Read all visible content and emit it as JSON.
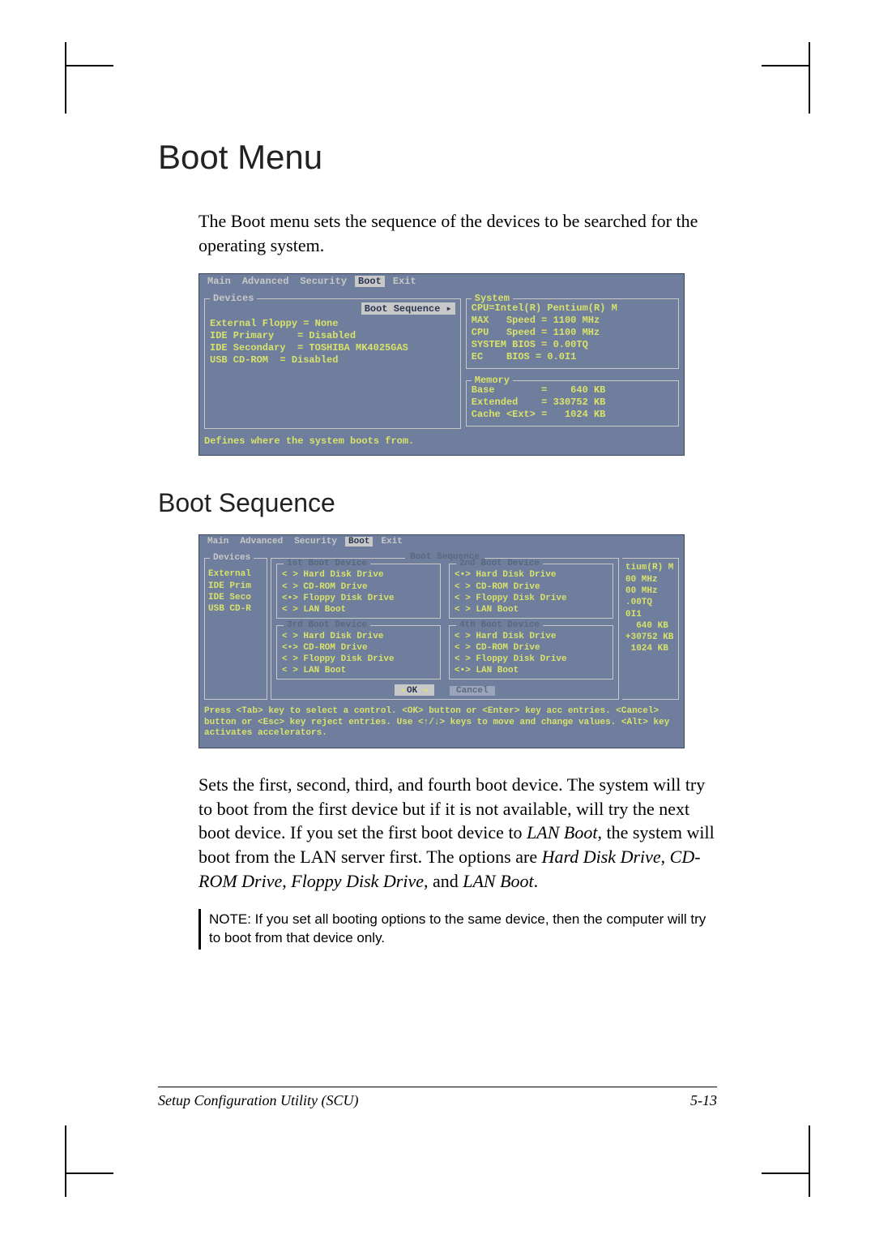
{
  "title": "Boot Menu",
  "intro": "The Boot menu sets the sequence of the devices to be searched for the operating system.",
  "bios1": {
    "menubar": [
      "Main",
      "Advanced",
      "Security",
      "Boot",
      "Exit"
    ],
    "active_tab": "Boot",
    "devices_title": "Devices",
    "boot_seq_button": "Boot Sequence ▸",
    "dev_lines": [
      "External Floppy = None",
      "IDE Primary    = Disabled",
      "IDE Secondary  = TOSHIBA MK4025GAS",
      "USB CD-ROM  = Disabled"
    ],
    "system_title": "System",
    "system_lines": [
      "CPU=Intel(R) Pentium(R) M",
      "MAX   Speed = 1100 MHz",
      "CPU   Speed = 1100 MHz",
      "SYSTEM BIOS = 0.00TQ",
      "EC    BIOS = 0.0I1"
    ],
    "memory_title": "Memory",
    "memory_lines": [
      "Base        =    640 KB",
      "Extended    = 330752 KB",
      "Cache <Ext> =   1024 KB"
    ],
    "status": "Defines where the system boots from."
  },
  "subtitle": "Boot Sequence",
  "bios2": {
    "menubar": [
      "Main",
      "Advanced",
      "Security",
      "Boot",
      "Exit"
    ],
    "active_tab": "Boot",
    "devices_title": "Devices",
    "dev_left": [
      "External",
      "IDE Prim",
      "IDE Seco",
      "USB CD-R"
    ],
    "seq_title": "Boot Sequence",
    "box1_title": "1st Boot Device",
    "box2_title": "2nd Boot Device",
    "box3_title": "3rd Boot Device",
    "box4_title": "4th Boot Device",
    "box1_opts": [
      "< > Hard Disk Drive",
      "< > CD-ROM Drive",
      "<•> Floppy Disk Drive",
      "< > LAN Boot"
    ],
    "box2_opts": [
      "<•> Hard Disk Drive",
      "< > CD-ROM Drive",
      "< > Floppy Disk Drive",
      "< > LAN Boot"
    ],
    "box3_opts": [
      "< > Hard Disk Drive",
      "<•> CD-ROM Drive",
      "< > Floppy Disk Drive",
      "< > LAN Boot"
    ],
    "box4_opts": [
      "< > Hard Disk Drive",
      "< > CD-ROM Drive",
      "< > Floppy Disk Drive",
      "<•> LAN Boot"
    ],
    "ok": "OK",
    "cancel": "Cancel",
    "right_strip": [
      "tium(R) M",
      "00 MHz",
      "00 MHz",
      ".00TQ",
      "0I1",
      "",
      "  640 KB",
      "+30752 KB",
      " 1024 KB"
    ],
    "help": "Press <Tab> key to select a control. <OK> button or <Enter> key acc\nentries. <Cancel> button or <Esc> key reject entries. Use <↑/↓> keys to move\nand change values. <Alt> key activates accelerators."
  },
  "desc_parts": {
    "p1": "Sets the first, second, third, and fourth boot device. The system will try to boot from the first device but if it is not available, will try the next boot device. If you set the first boot device to ",
    "i1": "LAN Boot",
    "p2": ", the system will boot from the LAN server first. The options are ",
    "i2": "Hard Disk Drive",
    "p3": ", ",
    "i3": "CD-ROM Drive",
    "p4": ", ",
    "i4": "Floppy Disk Drive",
    "p5": ", and ",
    "i5": "LAN Boot",
    "p6": "."
  },
  "note_label": "NOTE: ",
  "note_text": "If you set all booting options to the same device, then the computer will try to boot from that device only.",
  "footer_left": "Setup Configuration Utility (SCU)",
  "footer_right": "5-13"
}
